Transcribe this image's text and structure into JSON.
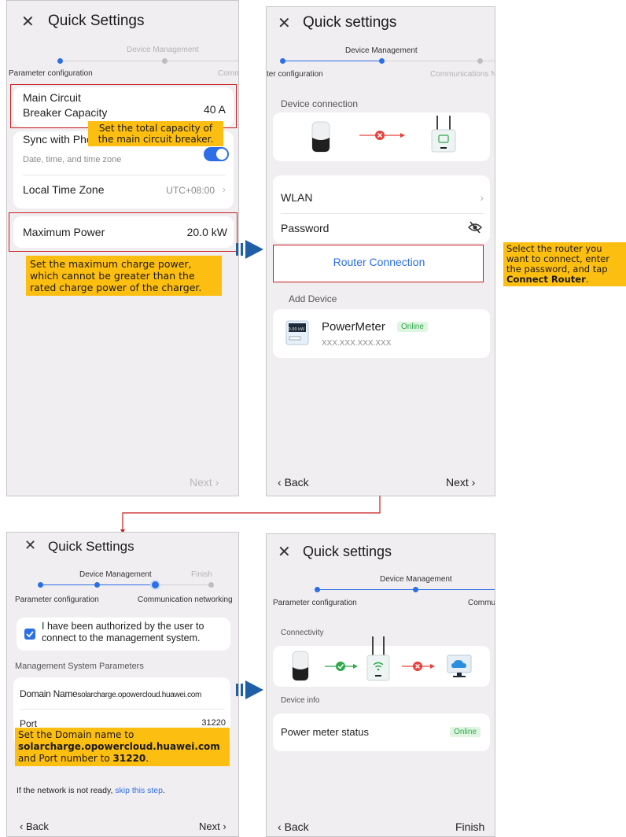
{
  "panel1": {
    "title": "Quick Settings",
    "steps": {
      "step1": "Parameter configuration",
      "step2": "Device Management",
      "step3": "Comm"
    },
    "breaker": {
      "label_line1": "Main Circuit",
      "label_line2": "Breaker Capacity",
      "value": "40  A"
    },
    "breaker_note": "Set the total capacity of the main circuit breaker.",
    "sync": {
      "label": "Sync with Phone",
      "sub": "Date, time, and time zone"
    },
    "timezone": {
      "label": "Local Time Zone",
      "value": "UTC+08:00"
    },
    "max_power": {
      "label": "Maximum Power",
      "value": "20.0  kW"
    },
    "power_note": "Set the maximum charge power, which cannot be greater than the rated charge power of the charger.",
    "next": "Next"
  },
  "panel2": {
    "title": "Quick settings",
    "steps": {
      "step1": "ter configuration",
      "step2": "Device Management",
      "step3": "Communications N"
    },
    "section_connection": "Device connection",
    "wlan": "WLAN",
    "password": "Password",
    "router_button": "Router Connection",
    "section_add": "Add Device",
    "device": {
      "name": "PowerMeter",
      "status": "Online",
      "ip": "XXX.XXX.XXX.XXX",
      "screen": "0.00 kW"
    },
    "back": "Back",
    "next": "Next"
  },
  "side_note": {
    "text1": "Select the router you want to connect, enter the password, and tap ",
    "bold": "Connect Router",
    "text2": "."
  },
  "panel3": {
    "title": "Quick Settings",
    "steps": {
      "step1": "Parameter configuration",
      "step2": "Device Management",
      "step3": "Communication networking",
      "step4": "Finish"
    },
    "auth_text": "I have been authorized by the user to connect to the management system.",
    "section": "Management System Parameters",
    "domain": {
      "label": "Domain Name",
      "value": "solarcharge.opowercloud.huawei.com"
    },
    "port": {
      "label": "Port",
      "value": "31220"
    },
    "note": {
      "t1": "Set the Domain name to ",
      "b1": "solarcharge.opowercloud.huawei.com",
      "t2": " and Port number to ",
      "b2": "31220",
      "t3": "."
    },
    "skip": {
      "text": "If the network is not ready, ",
      "link": "skip this step",
      "end": "."
    },
    "back": "Back",
    "next": "Next"
  },
  "panel4": {
    "title": "Quick settings",
    "steps": {
      "step1": "Parameter configuration",
      "step2": "Device Management",
      "step3": "Commur"
    },
    "section_connectivity": "Connectivity",
    "section_info": "Device info",
    "meter": {
      "label": "Power meter status",
      "status": "Online"
    },
    "back": "Back",
    "finish": "Finish"
  },
  "colors": {
    "accent": "#2b6ee8",
    "highlight": "#fdbe12",
    "frame": "#c71c1c",
    "arrow": "#1f5fa8"
  }
}
